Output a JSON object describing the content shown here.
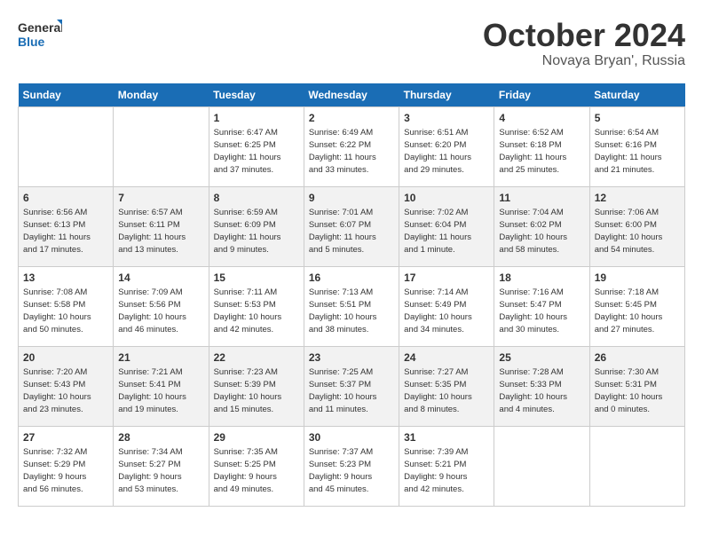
{
  "logo": {
    "line1": "General",
    "line2": "Blue"
  },
  "title": "October 2024",
  "subtitle": "Novaya Bryan', Russia",
  "days_header": [
    "Sunday",
    "Monday",
    "Tuesday",
    "Wednesday",
    "Thursday",
    "Friday",
    "Saturday"
  ],
  "weeks": [
    [
      {
        "day": "",
        "info": ""
      },
      {
        "day": "",
        "info": ""
      },
      {
        "day": "1",
        "info": "Sunrise: 6:47 AM\nSunset: 6:25 PM\nDaylight: 11 hours\nand 37 minutes."
      },
      {
        "day": "2",
        "info": "Sunrise: 6:49 AM\nSunset: 6:22 PM\nDaylight: 11 hours\nand 33 minutes."
      },
      {
        "day": "3",
        "info": "Sunrise: 6:51 AM\nSunset: 6:20 PM\nDaylight: 11 hours\nand 29 minutes."
      },
      {
        "day": "4",
        "info": "Sunrise: 6:52 AM\nSunset: 6:18 PM\nDaylight: 11 hours\nand 25 minutes."
      },
      {
        "day": "5",
        "info": "Sunrise: 6:54 AM\nSunset: 6:16 PM\nDaylight: 11 hours\nand 21 minutes."
      }
    ],
    [
      {
        "day": "6",
        "info": "Sunrise: 6:56 AM\nSunset: 6:13 PM\nDaylight: 11 hours\nand 17 minutes."
      },
      {
        "day": "7",
        "info": "Sunrise: 6:57 AM\nSunset: 6:11 PM\nDaylight: 11 hours\nand 13 minutes."
      },
      {
        "day": "8",
        "info": "Sunrise: 6:59 AM\nSunset: 6:09 PM\nDaylight: 11 hours\nand 9 minutes."
      },
      {
        "day": "9",
        "info": "Sunrise: 7:01 AM\nSunset: 6:07 PM\nDaylight: 11 hours\nand 5 minutes."
      },
      {
        "day": "10",
        "info": "Sunrise: 7:02 AM\nSunset: 6:04 PM\nDaylight: 11 hours\nand 1 minute."
      },
      {
        "day": "11",
        "info": "Sunrise: 7:04 AM\nSunset: 6:02 PM\nDaylight: 10 hours\nand 58 minutes."
      },
      {
        "day": "12",
        "info": "Sunrise: 7:06 AM\nSunset: 6:00 PM\nDaylight: 10 hours\nand 54 minutes."
      }
    ],
    [
      {
        "day": "13",
        "info": "Sunrise: 7:08 AM\nSunset: 5:58 PM\nDaylight: 10 hours\nand 50 minutes."
      },
      {
        "day": "14",
        "info": "Sunrise: 7:09 AM\nSunset: 5:56 PM\nDaylight: 10 hours\nand 46 minutes."
      },
      {
        "day": "15",
        "info": "Sunrise: 7:11 AM\nSunset: 5:53 PM\nDaylight: 10 hours\nand 42 minutes."
      },
      {
        "day": "16",
        "info": "Sunrise: 7:13 AM\nSunset: 5:51 PM\nDaylight: 10 hours\nand 38 minutes."
      },
      {
        "day": "17",
        "info": "Sunrise: 7:14 AM\nSunset: 5:49 PM\nDaylight: 10 hours\nand 34 minutes."
      },
      {
        "day": "18",
        "info": "Sunrise: 7:16 AM\nSunset: 5:47 PM\nDaylight: 10 hours\nand 30 minutes."
      },
      {
        "day": "19",
        "info": "Sunrise: 7:18 AM\nSunset: 5:45 PM\nDaylight: 10 hours\nand 27 minutes."
      }
    ],
    [
      {
        "day": "20",
        "info": "Sunrise: 7:20 AM\nSunset: 5:43 PM\nDaylight: 10 hours\nand 23 minutes."
      },
      {
        "day": "21",
        "info": "Sunrise: 7:21 AM\nSunset: 5:41 PM\nDaylight: 10 hours\nand 19 minutes."
      },
      {
        "day": "22",
        "info": "Sunrise: 7:23 AM\nSunset: 5:39 PM\nDaylight: 10 hours\nand 15 minutes."
      },
      {
        "day": "23",
        "info": "Sunrise: 7:25 AM\nSunset: 5:37 PM\nDaylight: 10 hours\nand 11 minutes."
      },
      {
        "day": "24",
        "info": "Sunrise: 7:27 AM\nSunset: 5:35 PM\nDaylight: 10 hours\nand 8 minutes."
      },
      {
        "day": "25",
        "info": "Sunrise: 7:28 AM\nSunset: 5:33 PM\nDaylight: 10 hours\nand 4 minutes."
      },
      {
        "day": "26",
        "info": "Sunrise: 7:30 AM\nSunset: 5:31 PM\nDaylight: 10 hours\nand 0 minutes."
      }
    ],
    [
      {
        "day": "27",
        "info": "Sunrise: 7:32 AM\nSunset: 5:29 PM\nDaylight: 9 hours\nand 56 minutes."
      },
      {
        "day": "28",
        "info": "Sunrise: 7:34 AM\nSunset: 5:27 PM\nDaylight: 9 hours\nand 53 minutes."
      },
      {
        "day": "29",
        "info": "Sunrise: 7:35 AM\nSunset: 5:25 PM\nDaylight: 9 hours\nand 49 minutes."
      },
      {
        "day": "30",
        "info": "Sunrise: 7:37 AM\nSunset: 5:23 PM\nDaylight: 9 hours\nand 45 minutes."
      },
      {
        "day": "31",
        "info": "Sunrise: 7:39 AM\nSunset: 5:21 PM\nDaylight: 9 hours\nand 42 minutes."
      },
      {
        "day": "",
        "info": ""
      },
      {
        "day": "",
        "info": ""
      }
    ]
  ]
}
